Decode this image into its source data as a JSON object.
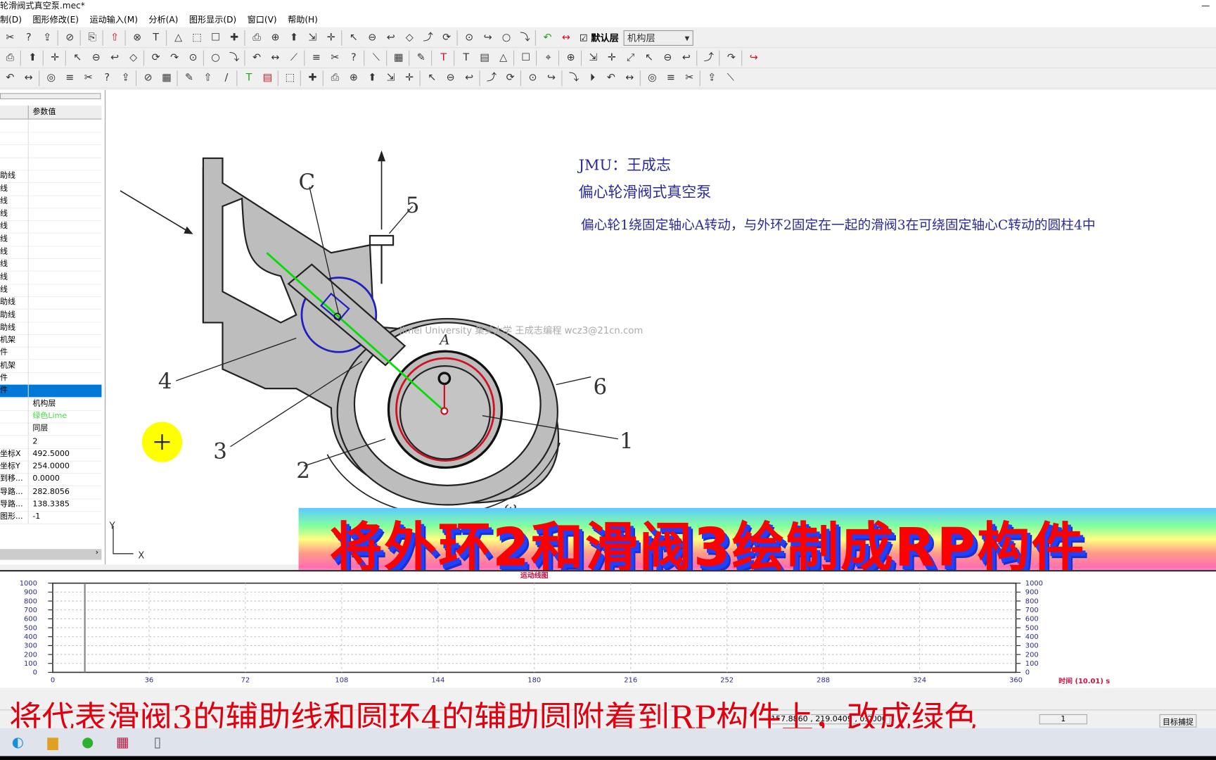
{
  "window": {
    "title": "轮滑阀式真空泵.mec*"
  },
  "menu": [
    "制(D)",
    "图形修改(E)",
    "运动输入(M)",
    "分析(A)",
    "图形显示(D)",
    "窗口(V)",
    "帮助(H)"
  ],
  "toolbar": {
    "row1": [
      "cut-icon",
      "copy-icon",
      "paste-icon",
      "|",
      "print-icon",
      "|",
      "pointer-icon",
      "|",
      "redo-icon",
      "|",
      "undo-icon",
      "undo2-icon",
      "|",
      "help-icon",
      "whats-this-icon",
      "mechanism-icon",
      "angle-icon",
      "|",
      "zoom-all-icon",
      "zoom-window-icon",
      "zoom-in-icon",
      "zoom-out-icon",
      "zoom-prev-icon",
      "|",
      "link-add-icon",
      "link-remove-icon",
      "export-icon",
      "upload-icon",
      "import-icon",
      "output-icon",
      "|",
      "arrow-left-icon",
      "edit-a-icon",
      "edit-b-icon",
      "edit-c-icon",
      "|",
      "green-link-icon",
      "red-link-icon"
    ],
    "default_layer_label": "默认层",
    "layer_combo": "机构层",
    "row2": [
      "ruler-icon",
      "|",
      "line-icon",
      "|",
      "spring-icon",
      "|",
      "slider-icon",
      "slider2-icon",
      "ground-icon",
      "rack-icon",
      "|",
      "gear-a-icon",
      "gear-b-icon",
      "gear-c-icon",
      "|",
      "triangle-icon",
      "caret-icon",
      "|",
      "link2-icon",
      "link3-icon",
      "block-icon",
      "|",
      "cam-a-icon",
      "cam-b-icon",
      "fork-icon",
      "|",
      "polygon-icon",
      "|",
      "pentagon-icon",
      "|",
      "stroke-icon",
      "|",
      "text-icon",
      "|",
      "pen-icon",
      "hline-icon",
      "cross-icon",
      "|",
      "film-icon",
      "|",
      "scissors-icon",
      "|",
      "node-icon",
      "|",
      "move-icon",
      "rotate-icon",
      "mirror-icon",
      "pan-icon",
      "trim-icon",
      "extend-icon",
      "|",
      "fillet-icon",
      "|",
      "play-icon",
      "|",
      "tt-icon"
    ],
    "row3": [
      "x-icon",
      "v-icon",
      "|",
      "circle-a-icon",
      "circle-b-icon",
      "circle-c-icon",
      "arc-a-icon",
      "arc-b-icon",
      "|",
      "curve-a-icon",
      "curve-b-icon",
      "|",
      "target-icon",
      "hand-icon",
      "apple-icon",
      "|",
      "check-color-icon",
      "check-red-icon",
      "|",
      "frame-icon",
      "|",
      "chart-icon",
      "|",
      "snap-a-icon",
      "snap-b-icon",
      "snap-c-icon",
      "snap-d-icon",
      "snap-e-icon",
      "|",
      "ring-a-icon",
      "ring-b-icon",
      "ring-c-icon",
      "|",
      "ring-d-icon",
      "ring-e-icon",
      "|",
      "ring-f-icon",
      "ring-g-icon",
      "|",
      "align-icon",
      "grid-icon",
      "grid2-icon",
      "angle2-icon",
      "|",
      "edit-box-icon",
      "strike-icon",
      "image-icon",
      "|",
      "brush-icon",
      "table-icon"
    ]
  },
  "left_panel": {
    "header_value": "参数值",
    "rows": [
      {
        "k": "",
        "v": ""
      },
      {
        "k": "",
        "v": ""
      },
      {
        "k": "",
        "v": ""
      },
      {
        "k": "",
        "v": ""
      },
      {
        "k": "助线",
        "v": ""
      },
      {
        "k": "线",
        "v": ""
      },
      {
        "k": "线",
        "v": ""
      },
      {
        "k": "线",
        "v": ""
      },
      {
        "k": "线",
        "v": ""
      },
      {
        "k": "线",
        "v": ""
      },
      {
        "k": "线",
        "v": ""
      },
      {
        "k": "线",
        "v": ""
      },
      {
        "k": "线",
        "v": ""
      },
      {
        "k": "线",
        "v": ""
      },
      {
        "k": "助线",
        "v": ""
      },
      {
        "k": "助线",
        "v": ""
      },
      {
        "k": "助线",
        "v": ""
      },
      {
        "k": "机架",
        "v": ""
      },
      {
        "k": "件",
        "v": ""
      },
      {
        "k": "机架",
        "v": ""
      },
      {
        "k": "件",
        "v": ""
      },
      {
        "k": "件",
        "v": "",
        "selected": true
      },
      {
        "k": "",
        "v": "机构层"
      },
      {
        "k": "",
        "v": "绿色Lime",
        "color": "#44dd44"
      },
      {
        "k": "",
        "v": "同层"
      },
      {
        "k": "",
        "v": "2"
      },
      {
        "k": "坐标X",
        "v": "492.5000"
      },
      {
        "k": "坐标Y",
        "v": "254.0000"
      },
      {
        "k": "到移...",
        "v": "0.0000"
      },
      {
        "k": "导路...",
        "v": "282.8056"
      },
      {
        "k": "导路...",
        "v": "138.3385"
      },
      {
        "k": "图形...",
        "v": "-1"
      }
    ]
  },
  "canvas": {
    "author": "JMU：王成志",
    "name": "偏心轮滑阀式真空泵",
    "description": "偏心轮1绕固定轴心A转动，与外环2固定在一起的滑阀3在可绕固定轴心C转动的圆柱4中",
    "watermark": "Jimei University 集美大学 王成志编程  wcz3@21cn.com",
    "labels": {
      "c": "C",
      "a": "A",
      "n1": "1",
      "n2": "2",
      "n3": "3",
      "n4": "4",
      "n5": "5",
      "n6": "6",
      "omega": "ω"
    },
    "axis_y": "Y",
    "axis_x": "X",
    "colors": {
      "guide_line": "#00e000",
      "ring": "#2020c0",
      "red_ring": "#d01020",
      "cursor_highlight": "#ffff00"
    }
  },
  "overlay": {
    "banner": "将外环2和滑阀3绘制成RP构件",
    "subtitle": "将代表滑阀3的辅助线和圆环4的辅助圆附着到RP构件上，改成绿色"
  },
  "chart_data": {
    "type": "line",
    "title": "运动线图",
    "xlabel": "时间 (10.01) s",
    "ylabel": "",
    "xlim": [
      0,
      360
    ],
    "ylim": [
      0,
      1000
    ],
    "x_ticks": [
      0,
      36,
      72,
      108,
      144,
      180,
      216,
      252,
      288,
      324,
      360
    ],
    "y_ticks": [
      0,
      100,
      200,
      300,
      400,
      500,
      600,
      700,
      800,
      900,
      1000
    ],
    "grid": true,
    "series": [],
    "cursor_x": 12
  },
  "status": {
    "coords": "157.8860 , 219.0409 , 0.0000",
    "page": "1",
    "snap": "目标捕捉"
  },
  "taskbar": [
    {
      "icon": "edge-icon",
      "glyph": "◐"
    },
    {
      "icon": "file-explorer-icon",
      "glyph": "▆"
    },
    {
      "icon": "wechat-icon",
      "glyph": "●"
    },
    {
      "icon": "mechanism-app-icon",
      "glyph": "▦"
    },
    {
      "icon": "notepad-icon",
      "glyph": "▯"
    }
  ]
}
